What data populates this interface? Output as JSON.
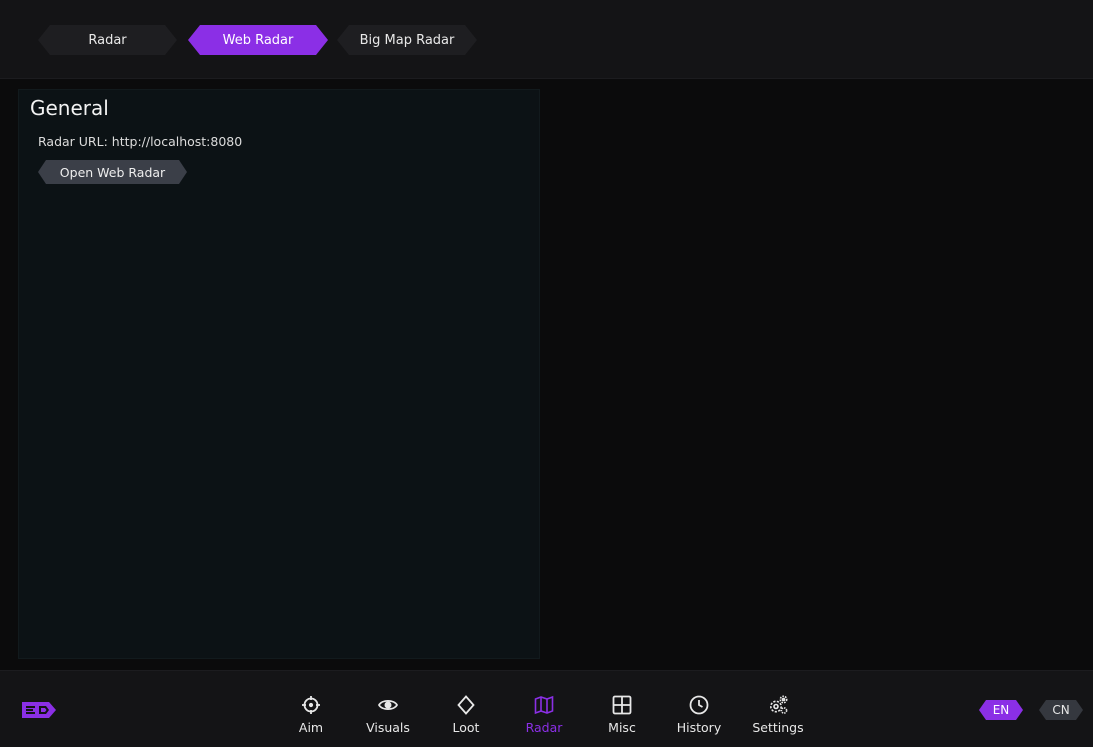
{
  "tabs": [
    {
      "label": "Radar",
      "active": false
    },
    {
      "label": "Web Radar",
      "active": true
    },
    {
      "label": "Big Map Radar",
      "active": false
    }
  ],
  "panel": {
    "title": "General",
    "url_label": "Radar URL:",
    "url_value": "http://localhost:8080",
    "open_button": "Open Web Radar"
  },
  "nav": [
    {
      "label": "Aim",
      "icon": "crosshair-icon"
    },
    {
      "label": "Visuals",
      "icon": "eye-icon"
    },
    {
      "label": "Loot",
      "icon": "diamond-icon"
    },
    {
      "label": "Radar",
      "icon": "map-icon",
      "active": true
    },
    {
      "label": "Misc",
      "icon": "grid-icon"
    },
    {
      "label": "History",
      "icon": "clock-icon"
    },
    {
      "label": "Settings",
      "icon": "gears-icon"
    }
  ],
  "languages": {
    "en": "EN",
    "cn": "CN"
  },
  "colors": {
    "accent": "#8b2fe6",
    "panel_bg": "#0c1215",
    "bar_bg": "#141416"
  }
}
